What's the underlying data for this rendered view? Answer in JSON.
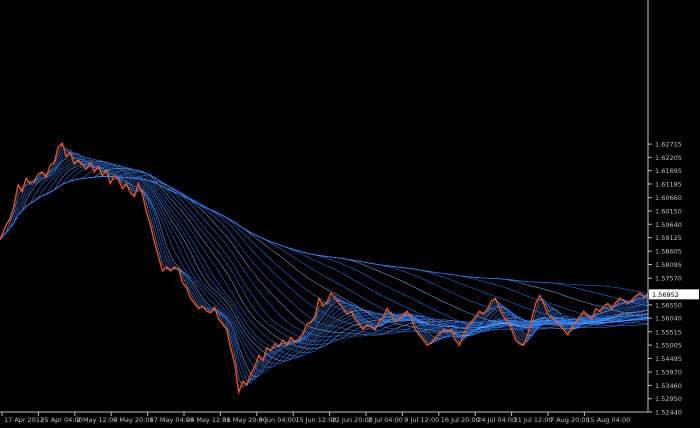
{
  "chart_data": {
    "type": "line",
    "background_color": "#000000",
    "axis_color": "#c0c0c0",
    "price_line_color": "#e8552a",
    "ribbon_color": "#2e7fff",
    "ribbon_highlight_color": "#7ab8ff",
    "ylim": [
      1.5244,
      1.6778
    ],
    "y_ticks": [
      "1.62715",
      "1.62205",
      "1.61695",
      "1.61185",
      "1.60660",
      "1.60150",
      "1.59640",
      "1.59125",
      "1.58605",
      "1.58095",
      "1.57570",
      "1.57060",
      "1.56550",
      "1.56040",
      "1.55515",
      "1.55005",
      "1.54495",
      "1.53970",
      "1.53460",
      "1.52950",
      "1.52440"
    ],
    "current_price_label": "1.56952",
    "x_ticks": [
      "17 Apr 2012",
      "25 Apr 04:00",
      "2 May 12:00",
      "9 May 20:00",
      "17 May 04:00",
      "24 May 12:00",
      "31 May 20:00",
      "8 Jun 04:00",
      "15 Jun 12:00",
      "22 Jun 20:00",
      "2 Jul 04:00",
      "9 Jul 12:00",
      "16 Jul 20:00",
      "24 Jul 04:00",
      "31 Jul 12:00",
      "7 Aug 20:00",
      "15 Aug 04:00"
    ],
    "x_range": [
      0,
      646
    ],
    "series": [
      {
        "values": [
          [
            0,
            1.5905
          ],
          [
            6,
            1.596
          ],
          [
            10,
            1.5985
          ],
          [
            14,
            1.6035
          ],
          [
            18,
            1.6115
          ],
          [
            22,
            1.609
          ],
          [
            26,
            1.614
          ],
          [
            30,
            1.612
          ],
          [
            34,
            1.613
          ],
          [
            38,
            1.6155
          ],
          [
            42,
            1.6165
          ],
          [
            46,
            1.6145
          ],
          [
            50,
            1.619
          ],
          [
            54,
            1.62
          ],
          [
            58,
            1.626
          ],
          [
            62,
            1.6275
          ],
          [
            66,
            1.6225
          ],
          [
            70,
            1.624
          ],
          [
            74,
            1.6195
          ],
          [
            78,
            1.621
          ],
          [
            82,
            1.619
          ],
          [
            86,
            1.6175
          ],
          [
            90,
            1.62
          ],
          [
            94,
            1.6165
          ],
          [
            98,
            1.6185
          ],
          [
            102,
            1.615
          ],
          [
            106,
            1.617
          ],
          [
            110,
            1.612
          ],
          [
            114,
            1.615
          ],
          [
            118,
            1.6135
          ],
          [
            122,
            1.61
          ],
          [
            126,
            1.612
          ],
          [
            130,
            1.6085
          ],
          [
            134,
            1.607
          ],
          [
            138,
            1.612
          ],
          [
            142,
            1.608
          ],
          [
            146,
            1.601
          ],
          [
            150,
            1.596
          ],
          [
            154,
            1.5895
          ],
          [
            158,
            1.584
          ],
          [
            162,
            1.5785
          ],
          [
            166,
            1.58
          ],
          [
            170,
            1.5785
          ],
          [
            174,
            1.58
          ],
          [
            178,
            1.579
          ],
          [
            182,
            1.574
          ],
          [
            186,
            1.572
          ],
          [
            190,
            1.568
          ],
          [
            194,
            1.566
          ],
          [
            198,
            1.564
          ],
          [
            202,
            1.565
          ],
          [
            206,
            1.563
          ],
          [
            210,
            1.5625
          ],
          [
            214,
            1.5645
          ],
          [
            218,
            1.56
          ],
          [
            222,
            1.558
          ],
          [
            226,
            1.556
          ],
          [
            230,
            1.549
          ],
          [
            234,
            1.543
          ],
          [
            238,
            1.532
          ],
          [
            242,
            1.536
          ],
          [
            246,
            1.535
          ],
          [
            250,
            1.539
          ],
          [
            254,
            1.542
          ],
          [
            258,
            1.546
          ],
          [
            262,
            1.544
          ],
          [
            266,
            1.549
          ],
          [
            270,
            1.548
          ],
          [
            274,
            1.5505
          ],
          [
            278,
            1.5495
          ],
          [
            282,
            1.552
          ],
          [
            286,
            1.55
          ],
          [
            290,
            1.553
          ],
          [
            294,
            1.551
          ],
          [
            298,
            1.5525
          ],
          [
            302,
            1.5545
          ],
          [
            306,
            1.558
          ],
          [
            310,
            1.559
          ],
          [
            314,
            1.561
          ],
          [
            318,
            1.568
          ],
          [
            322,
            1.565
          ],
          [
            326,
            1.5665
          ],
          [
            330,
            1.57
          ],
          [
            334,
            1.568
          ],
          [
            338,
            1.566
          ],
          [
            342,
            1.564
          ],
          [
            346,
            1.562
          ],
          [
            350,
            1.563
          ],
          [
            354,
            1.56
          ],
          [
            358,
            1.558
          ],
          [
            362,
            1.556
          ],
          [
            366,
            1.558
          ],
          [
            370,
            1.557
          ],
          [
            374,
            1.556
          ],
          [
            378,
            1.559
          ],
          [
            382,
            1.561
          ],
          [
            386,
            1.564
          ],
          [
            390,
            1.5615
          ],
          [
            394,
            1.559
          ],
          [
            398,
            1.56
          ],
          [
            402,
            1.562
          ],
          [
            406,
            1.563
          ],
          [
            410,
            1.56
          ],
          [
            414,
            1.556
          ],
          [
            418,
            1.554
          ],
          [
            422,
            1.552
          ],
          [
            426,
            1.55
          ],
          [
            430,
            1.551
          ],
          [
            434,
            1.553
          ],
          [
            438,
            1.5545
          ],
          [
            442,
            1.556
          ],
          [
            446,
            1.555
          ],
          [
            450,
            1.556
          ],
          [
            454,
            1.552
          ],
          [
            458,
            1.55
          ],
          [
            462,
            1.554
          ],
          [
            466,
            1.5575
          ],
          [
            470,
            1.559
          ],
          [
            474,
            1.561
          ],
          [
            478,
            1.563
          ],
          [
            482,
            1.562
          ],
          [
            486,
            1.564
          ],
          [
            490,
            1.567
          ],
          [
            494,
            1.568
          ],
          [
            498,
            1.564
          ],
          [
            502,
            1.561
          ],
          [
            506,
            1.559
          ],
          [
            510,
            1.556
          ],
          [
            514,
            1.552
          ],
          [
            518,
            1.5505
          ],
          [
            522,
            1.55
          ],
          [
            526,
            1.554
          ],
          [
            530,
            1.56
          ],
          [
            534,
            1.566
          ],
          [
            538,
            1.569
          ],
          [
            542,
            1.566
          ],
          [
            546,
            1.562
          ],
          [
            550,
            1.5605
          ],
          [
            554,
            1.559
          ],
          [
            558,
            1.5575
          ],
          [
            562,
            1.556
          ],
          [
            566,
            1.554
          ],
          [
            570,
            1.557
          ],
          [
            574,
            1.559
          ],
          [
            578,
            1.561
          ],
          [
            582,
            1.563
          ],
          [
            586,
            1.561
          ],
          [
            590,
            1.56
          ],
          [
            594,
            1.564
          ],
          [
            598,
            1.563
          ],
          [
            602,
            1.565
          ],
          [
            606,
            1.566
          ],
          [
            610,
            1.564
          ],
          [
            614,
            1.5665
          ],
          [
            618,
            1.568
          ],
          [
            622,
            1.567
          ],
          [
            626,
            1.566
          ],
          [
            630,
            1.5675
          ],
          [
            634,
            1.569
          ],
          [
            638,
            1.57
          ],
          [
            642,
            1.5685
          ],
          [
            646,
            1.5695
          ]
        ]
      }
    ],
    "grid": false,
    "legend": "none"
  }
}
